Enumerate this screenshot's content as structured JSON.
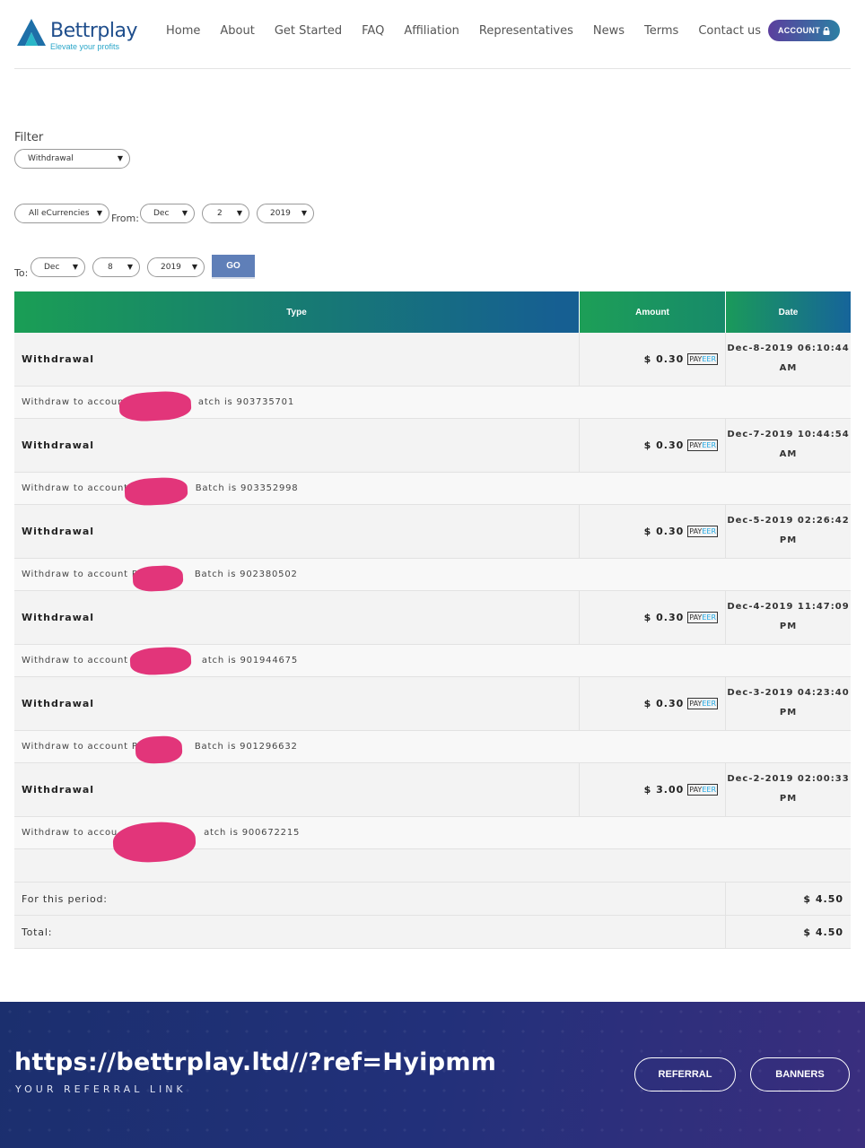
{
  "brand": {
    "name": "Bettrplay",
    "tagline": "Elevate your profits"
  },
  "nav": [
    "Home",
    "About",
    "Get Started",
    "FAQ",
    "Affiliation",
    "Representatives",
    "News",
    "Terms",
    "Contact us"
  ],
  "account_button": "ACCOUNT",
  "filter": {
    "label": "Filter",
    "type_select": "Withdrawal",
    "currency_select": "All eCurrencies",
    "from_label": "From:",
    "from": {
      "month": "Dec",
      "day": "2",
      "year": "2019"
    },
    "to_label": "To:",
    "to": {
      "month": "Dec",
      "day": "8",
      "year": "2019"
    },
    "go_button": "GO"
  },
  "table": {
    "headers": {
      "type": "Type",
      "amount": "Amount",
      "date": "Date"
    },
    "rows": [
      {
        "type": "Withdrawal",
        "amount": "$ 0.30",
        "date_line1": "Dec-8-2019 06:10:44",
        "date_line2": "AM",
        "desc_pre": "Withdraw to account",
        "desc_post": "atch is 903735701"
      },
      {
        "type": "Withdrawal",
        "amount": "$ 0.30",
        "date_line1": "Dec-7-2019 10:44:54",
        "date_line2": "AM",
        "desc_pre": "Withdraw to account P",
        "desc_post": "Batch is 903352998"
      },
      {
        "type": "Withdrawal",
        "amount": "$ 0.30",
        "date_line1": "Dec-5-2019 02:26:42",
        "date_line2": "PM",
        "desc_pre": "Withdraw to account P6",
        "desc_post": "Batch is 902380502"
      },
      {
        "type": "Withdrawal",
        "amount": "$ 0.30",
        "date_line1": "Dec-4-2019 11:47:09",
        "date_line2": "PM",
        "desc_pre": "Withdraw to account P6",
        "desc_post": "atch is 901944675"
      },
      {
        "type": "Withdrawal",
        "amount": "$ 0.30",
        "date_line1": "Dec-3-2019 04:23:40",
        "date_line2": "PM",
        "desc_pre": "Withdraw to account P6",
        "desc_post": "Batch is 901296632"
      },
      {
        "type": "Withdrawal",
        "amount": "$ 3.00",
        "date_line1": "Dec-2-2019 02:00:33",
        "date_line2": "PM",
        "desc_pre": "Withdraw to accou",
        "desc_post": "atch is 900672215"
      }
    ],
    "payment_badge": {
      "part1": "PAY",
      "part2": "EER"
    },
    "period_label": "For this period:",
    "period_value": "$ 4.50",
    "total_label": "Total:",
    "total_value": "$ 4.50"
  },
  "footer": {
    "referral_link": "https://bettrplay.ltd//?ref=Hyipmm",
    "caption": "YOUR REFERRAL LINK",
    "referral_button": "REFERRAL",
    "banners_button": "BANNERS"
  },
  "colors": {
    "accent": "#1a9e55",
    "primary": "#155a9a",
    "redaction": "#e2357a"
  }
}
